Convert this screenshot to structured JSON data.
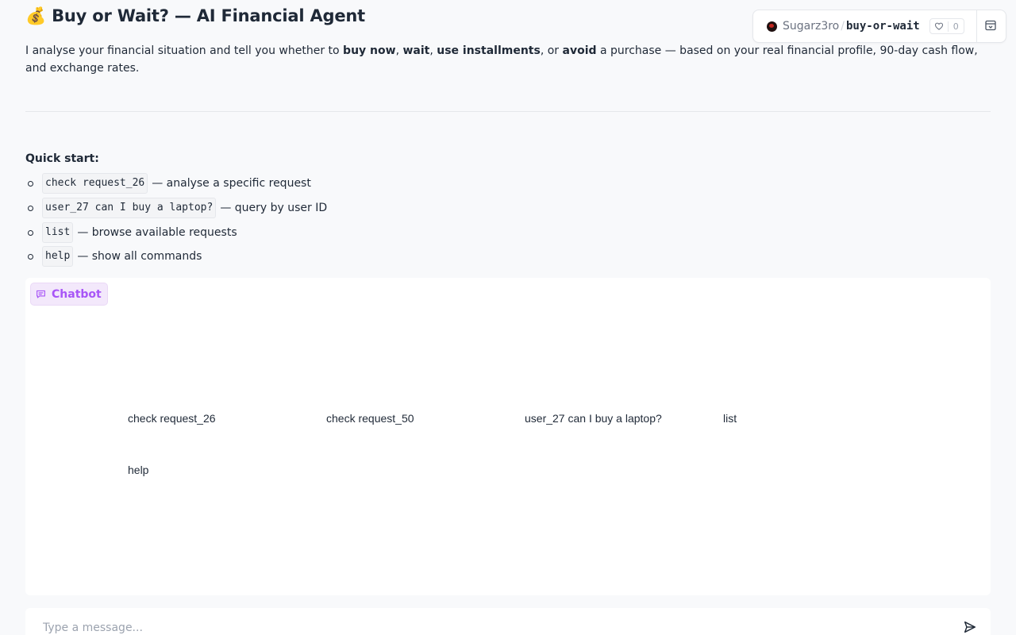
{
  "header": {
    "emoji": "💰",
    "title": "Buy or Wait? — AI Financial Agent"
  },
  "intro": {
    "part1": "I analyse your financial situation and tell you whether to ",
    "opt1": "buy now",
    "sep1": ", ",
    "opt2": "wait",
    "sep2": ", ",
    "opt3": "use installments",
    "sep3": ", or ",
    "opt4": "avoid",
    "part2": " a purchase — based on your real financial profile, 90-day cash flow, and exchange rates."
  },
  "quick_start": {
    "heading": "Quick start:",
    "items": [
      {
        "code": "check request_26",
        "desc": "— analyse a specific request"
      },
      {
        "code": "user_27 can I buy a laptop?",
        "desc": "— query by user ID"
      },
      {
        "code": "list",
        "desc": "— browse available requests"
      },
      {
        "code": "help",
        "desc": "— show all commands"
      }
    ]
  },
  "chatbot": {
    "label": "Chatbot",
    "examples": [
      "check request_26",
      "check request_50",
      "user_27 can I buy a laptop?",
      "list",
      "help"
    ]
  },
  "composer": {
    "placeholder": "Type a message..."
  },
  "space_badge": {
    "owner": "Sugarz3ro",
    "separator": "/",
    "repo": "buy-or-wait",
    "likes": "0"
  },
  "colors": {
    "accent": "#a855f7",
    "background": "#f8f9fb"
  }
}
